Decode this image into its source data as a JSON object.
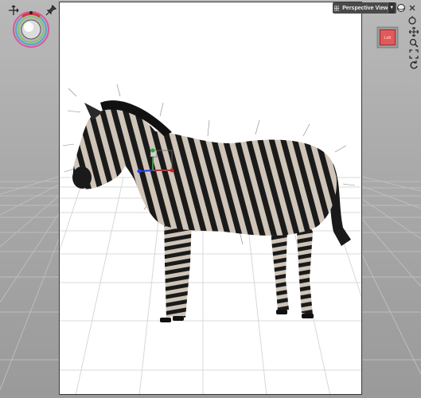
{
  "viewport": {
    "title": "Perspective View",
    "dropdown_icon": "chevron-down-icon",
    "camera_cube_label": "Left"
  },
  "tools": {
    "light_widget": "light-sphere-icon",
    "left_tools": [
      "move-axis-icon",
      "pin-icon"
    ],
    "right_tools": [
      "orbit-icon",
      "settings-icon",
      "pan-icon",
      "zoom-icon",
      "frame-icon",
      "reset-icon"
    ]
  },
  "colors": {
    "frame_bg": "#ffffff",
    "viewport_bg": "#a9a9a9",
    "grid_line": "#c8c8c8",
    "cube_face": "#e05a5a"
  }
}
